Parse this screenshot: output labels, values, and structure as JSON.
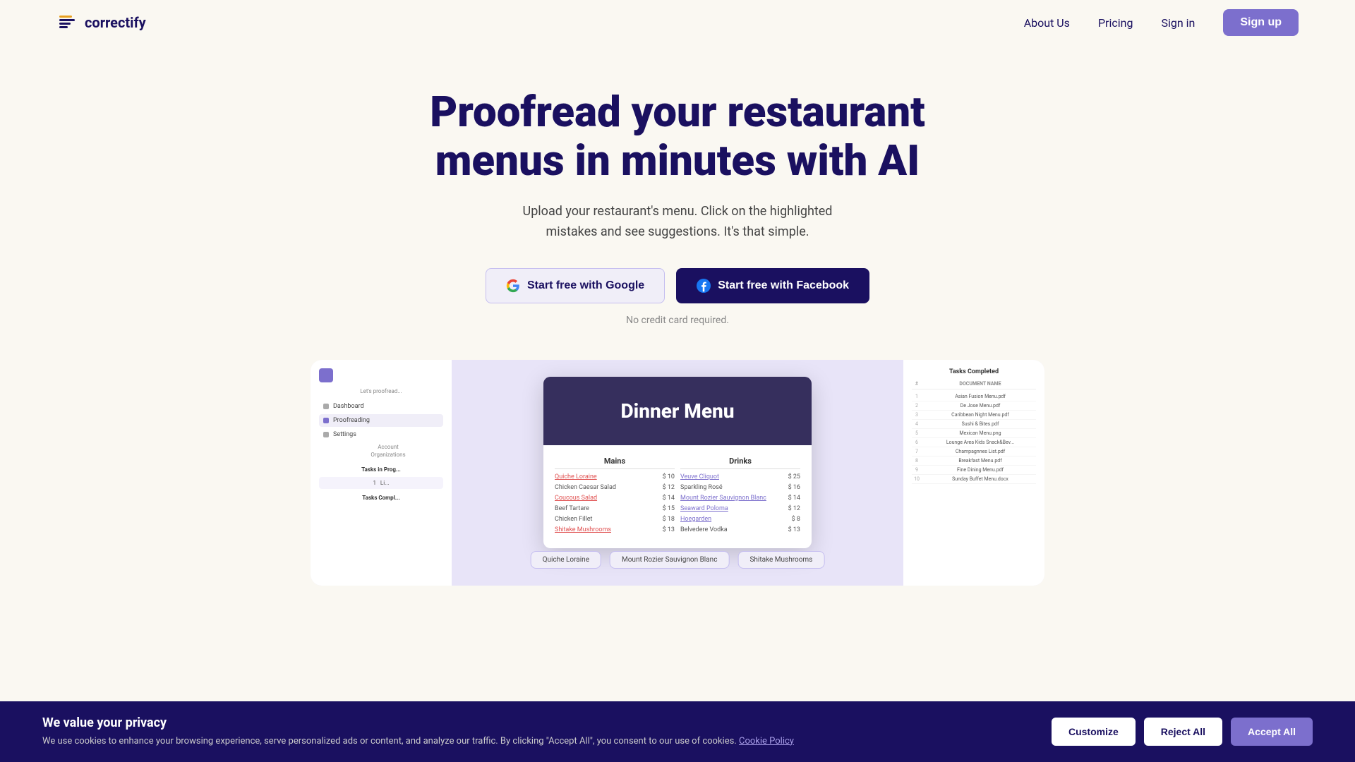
{
  "nav": {
    "logo_text": "correctify",
    "links": [
      {
        "label": "About Us",
        "id": "about-us"
      },
      {
        "label": "Pricing",
        "id": "pricing"
      }
    ],
    "signin_label": "Sign in",
    "signup_label": "Sign up"
  },
  "hero": {
    "title": "Proofread your restaurant menus in minutes with AI",
    "subtitle": "Upload your restaurant's menu. Click on the highlighted mistakes and see suggestions. It's that simple.",
    "btn_google": "Start free with Google",
    "btn_facebook": "Start free with Facebook",
    "no_card": "No credit card required."
  },
  "demo": {
    "dinner_menu_title": "Dinner Menu",
    "mains_header": "Mains",
    "drinks_header": "Drinks",
    "mains": [
      {
        "name": "Quiche Loraine",
        "price": "$ 10",
        "style": "underline-red"
      },
      {
        "name": "Chicken Caesar Salad",
        "price": "$ 12",
        "style": "normal"
      },
      {
        "name": "Coucous Salad",
        "price": "$ 14",
        "style": "underline-red"
      },
      {
        "name": "Beef Tartare",
        "price": "$ 15",
        "style": "normal"
      },
      {
        "name": "Chicken Fillet",
        "price": "$ 18",
        "style": "normal"
      },
      {
        "name": "Shitake Mushrooms",
        "price": "$ 13",
        "style": "underline-red"
      }
    ],
    "drinks": [
      {
        "name": "Veuve Cliquot",
        "price": "$ 25",
        "style": "underline-purple"
      },
      {
        "name": "Sparkling Rosé",
        "price": "$ 16",
        "style": "normal"
      },
      {
        "name": "Mount Rozier Sauvignon Blanc",
        "price": "$ 14",
        "style": "underline-purple"
      },
      {
        "name": "Seaward Poloma",
        "price": "$ 12",
        "style": "underline-purple"
      },
      {
        "name": "Hoegarden",
        "price": "$ 8",
        "style": "underline-purple"
      },
      {
        "name": "Belvedere Vodka",
        "price": "$ 13",
        "style": "normal"
      }
    ],
    "suggestions": [
      "Quiche Loraine",
      "Mount Rozier Sauvignon Blanc",
      "Shitake Mushrooms"
    ],
    "left_panel": {
      "proofreading_text": "Let's proofr...",
      "menu_items": [
        "Dashboard",
        "Proofreading",
        "Settings"
      ],
      "sub_items": [
        "Account",
        "Organizations"
      ],
      "tasks_in_progress": "Tasks in Prog...",
      "task_number": "1"
    },
    "right_panel": {
      "title": "Tasks Completed",
      "columns": [
        "#",
        "DOCUMENT NAME"
      ],
      "rows": [
        {
          "num": "1",
          "name": "Asian Fusion Menu.pdf"
        },
        {
          "num": "2",
          "name": "De Jose Menu.pdf"
        },
        {
          "num": "3",
          "name": "Caribbean Night Menu.pdf"
        },
        {
          "num": "4",
          "name": "Sushi & Bites.pdf"
        },
        {
          "num": "5",
          "name": "Mexican Menu.png"
        },
        {
          "num": "6",
          "name": "Lounge Area Kids Snack&Bev..."
        },
        {
          "num": "7",
          "name": "Champagnnes List.pdf"
        },
        {
          "num": "8",
          "name": "Breakfast Menu.pdf"
        },
        {
          "num": "9",
          "name": "Fine Dining Menu.pdf"
        },
        {
          "num": "10",
          "name": "Sunday Buffet Menu.docx"
        }
      ]
    }
  },
  "cookie": {
    "title": "We value your privacy",
    "description": "We use cookies to enhance your browsing experience, serve personalized ads or content, and analyze our traffic. By clicking \"Accept All\", you consent to our use of cookies.",
    "link_text": "Cookie Policy",
    "btn_customize": "Customize",
    "btn_reject": "Reject All",
    "btn_accept": "Accept All"
  },
  "colors": {
    "brand_purple": "#7c6fcd",
    "brand_dark": "#1a1060",
    "bg": "#faf8f2"
  }
}
